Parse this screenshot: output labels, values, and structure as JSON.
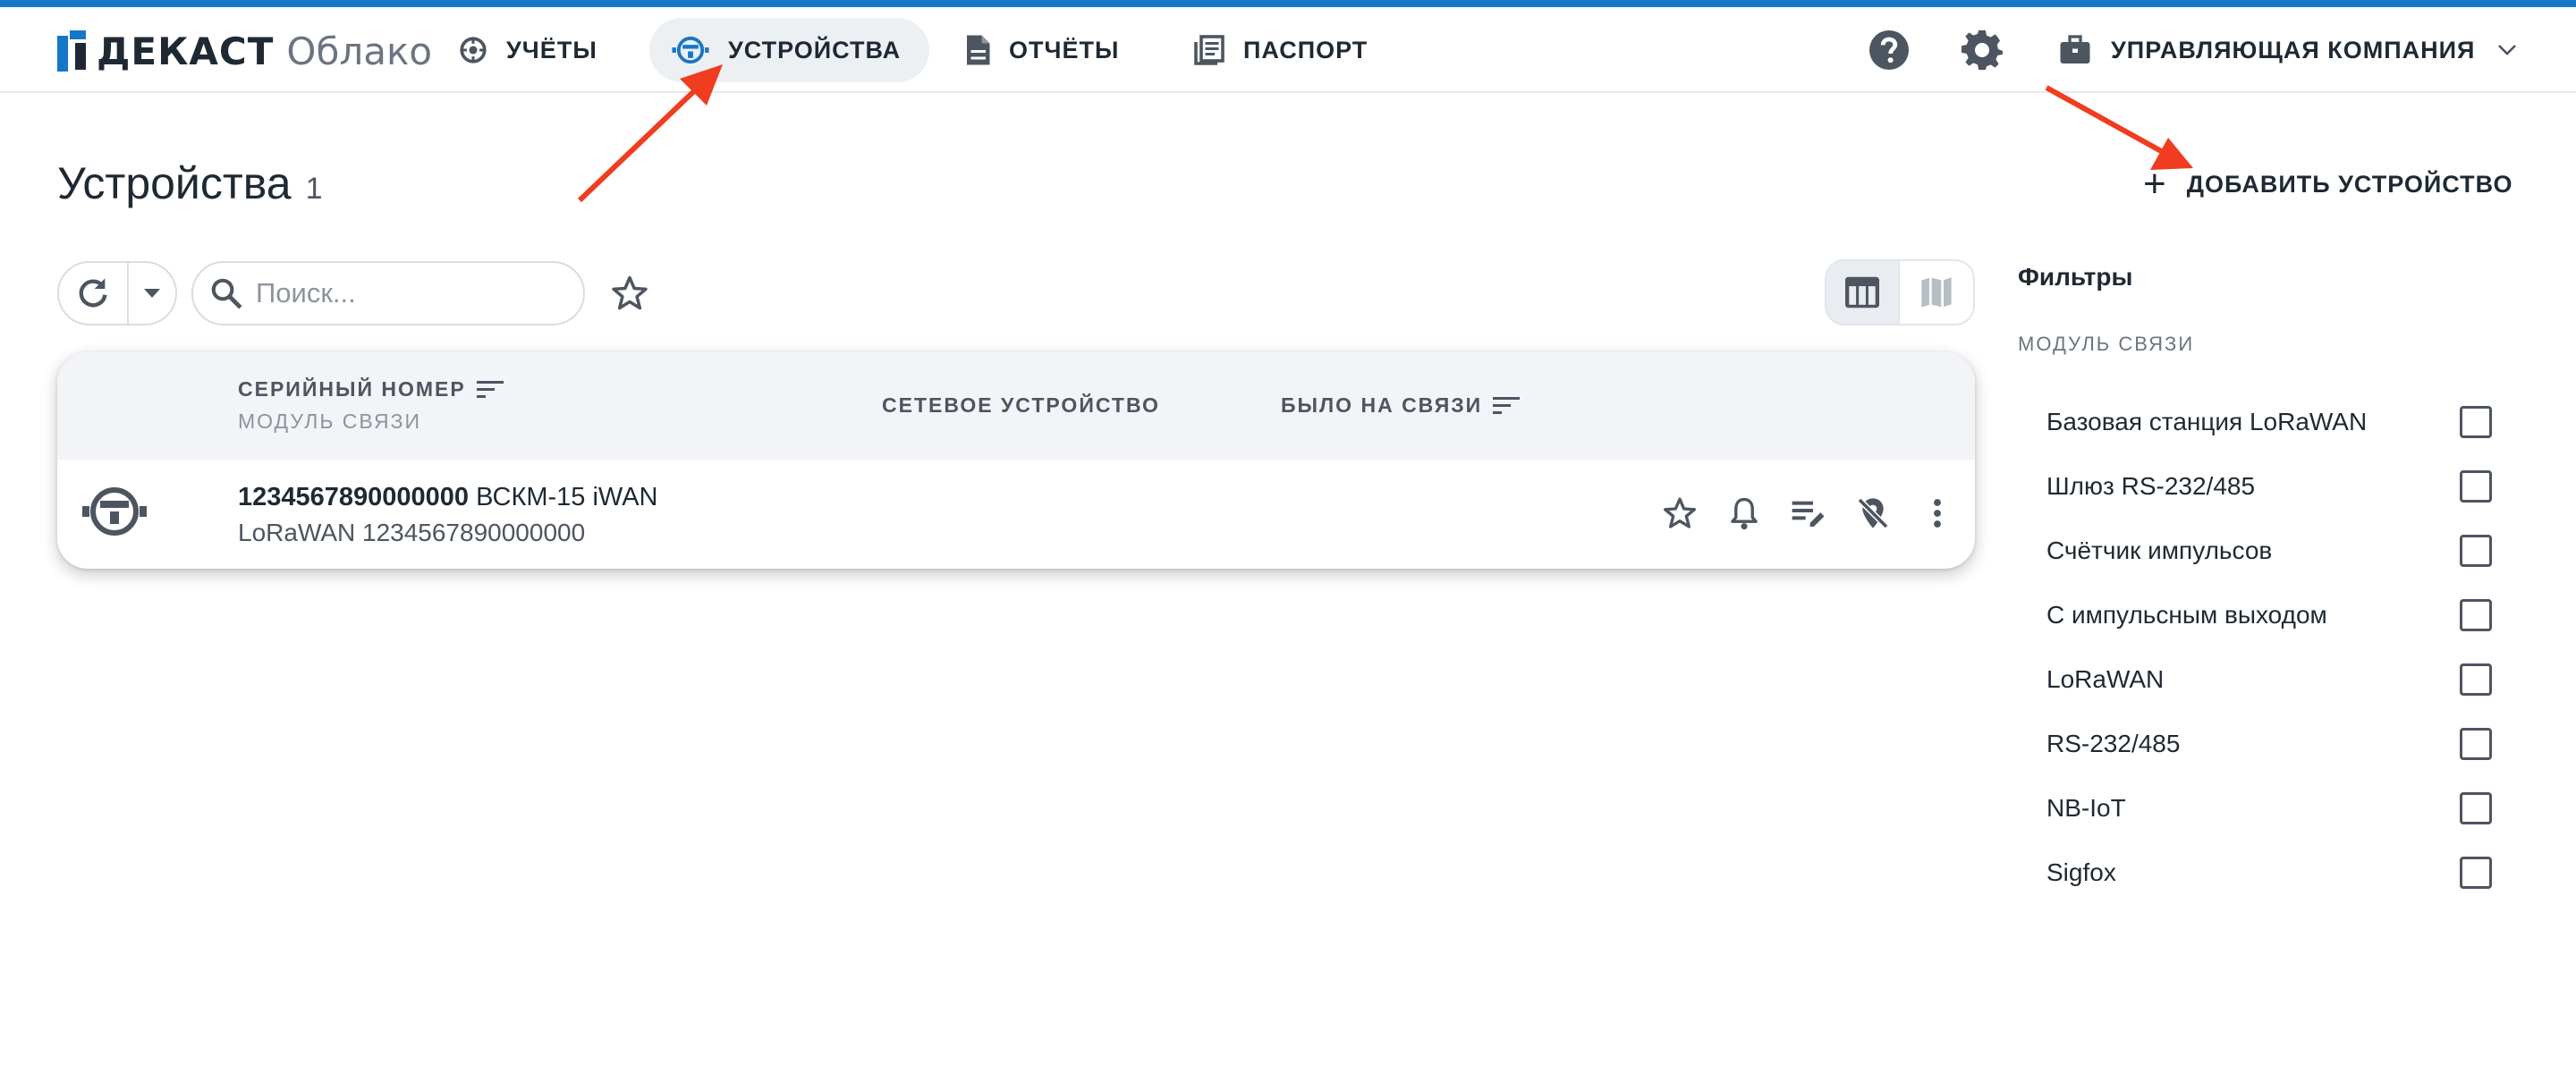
{
  "brand": {
    "name": "ДЕКАСТ",
    "product": "Облако"
  },
  "nav": [
    {
      "label": "УЧЁТЫ",
      "icon": "meter-icon"
    },
    {
      "label": "УСТРОЙСТВА",
      "icon": "device-icon",
      "active": true
    },
    {
      "label": "ОТЧЁТЫ",
      "icon": "document-icon"
    },
    {
      "label": "ПАСПОРТ",
      "icon": "passport-icon"
    }
  ],
  "header": {
    "company": "УПРАВЛЯЮЩАЯ КОМПАНИЯ"
  },
  "page": {
    "title": "Устройства",
    "count": "1",
    "add_label": "ДОБАВИТЬ УСТРОЙСТВО"
  },
  "toolbar": {
    "search_placeholder": "Поиск..."
  },
  "table": {
    "columns": {
      "serial": "СЕРИЙНЫЙ НОМЕР",
      "module": "МОДУЛЬ СВЯЗИ",
      "network": "СЕТЕВОЕ УСТРОЙСТВО",
      "last_seen": "БЫЛО НА СВЯЗИ"
    },
    "rows": [
      {
        "serial": "1234567890000000",
        "model": "ВСКМ-15 iWAN",
        "module": "LoRaWAN 1234567890000000"
      }
    ]
  },
  "filters": {
    "title": "Фильтры",
    "section": "МОДУЛЬ СВЯЗИ",
    "items": [
      {
        "label": "Базовая станция LoRaWAN",
        "checked": false
      },
      {
        "label": "Шлюз RS-232/485",
        "checked": false
      },
      {
        "label": "Счётчик импульсов",
        "checked": false
      },
      {
        "label": "С импульсным выходом",
        "checked": false
      },
      {
        "label": "LoRaWAN",
        "checked": false
      },
      {
        "label": "RS-232/485",
        "checked": false
      },
      {
        "label": "NB-IoT",
        "checked": false
      },
      {
        "label": "Sigfox",
        "checked": false
      }
    ]
  },
  "colors": {
    "accent": "#1677c8",
    "arrow": "#f03c1f",
    "text": "#1f2933"
  }
}
